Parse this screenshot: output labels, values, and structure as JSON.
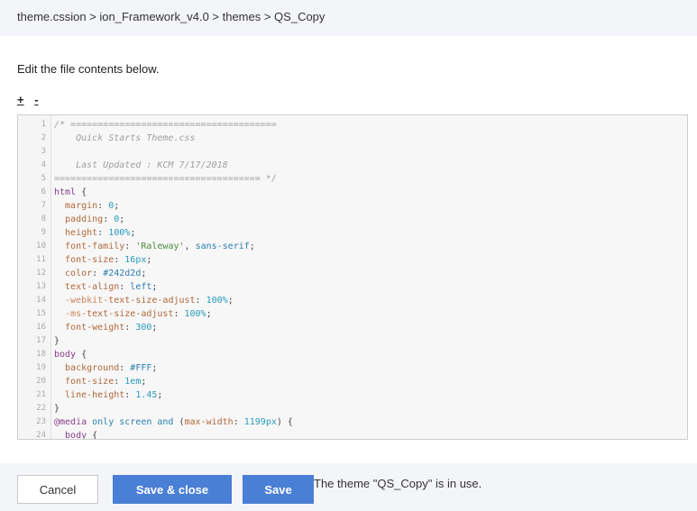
{
  "breadcrumb": {
    "text": "theme.cssion > ion_Framework_v4.0 > themes > QS_Copy"
  },
  "instructions": "Edit the file contents below.",
  "zoom": {
    "increase_label": "+",
    "decrease_label": "-"
  },
  "editor": {
    "lines": [
      {
        "num": "1",
        "tokens": [
          {
            "t": "/* ======================================",
            "c": "comment"
          }
        ]
      },
      {
        "num": "2",
        "tokens": [
          {
            "t": "    Quick Starts Theme.css",
            "c": "comment"
          }
        ]
      },
      {
        "num": "3",
        "tokens": [
          {
            "t": "",
            "c": "plain"
          }
        ]
      },
      {
        "num": "4",
        "tokens": [
          {
            "t": "    Last Updated : KCM 7/17/2018",
            "c": "comment"
          }
        ]
      },
      {
        "num": "5",
        "tokens": [
          {
            "t": "====================================== */",
            "c": "comment"
          }
        ]
      },
      {
        "num": "6",
        "tokens": [
          {
            "t": "html",
            "c": "selector"
          },
          {
            "t": " {",
            "c": "plain"
          }
        ]
      },
      {
        "num": "7",
        "tokens": [
          {
            "t": "  margin",
            "c": "prop"
          },
          {
            "t": ": ",
            "c": "plain"
          },
          {
            "t": "0",
            "c": "num"
          },
          {
            "t": ";",
            "c": "plain"
          }
        ]
      },
      {
        "num": "8",
        "tokens": [
          {
            "t": "  padding",
            "c": "prop"
          },
          {
            "t": ": ",
            "c": "plain"
          },
          {
            "t": "0",
            "c": "num"
          },
          {
            "t": ";",
            "c": "plain"
          }
        ]
      },
      {
        "num": "9",
        "tokens": [
          {
            "t": "  height",
            "c": "prop"
          },
          {
            "t": ": ",
            "c": "plain"
          },
          {
            "t": "100%",
            "c": "num"
          },
          {
            "t": ";",
            "c": "plain"
          }
        ]
      },
      {
        "num": "10",
        "tokens": [
          {
            "t": "  font-family",
            "c": "prop"
          },
          {
            "t": ": ",
            "c": "plain"
          },
          {
            "t": "'Raleway'",
            "c": "str"
          },
          {
            "t": ", ",
            "c": "plain"
          },
          {
            "t": "sans-serif",
            "c": "val"
          },
          {
            "t": ";",
            "c": "plain"
          }
        ]
      },
      {
        "num": "11",
        "tokens": [
          {
            "t": "  font-size",
            "c": "prop"
          },
          {
            "t": ": ",
            "c": "plain"
          },
          {
            "t": "16px",
            "c": "num"
          },
          {
            "t": ";",
            "c": "plain"
          }
        ]
      },
      {
        "num": "12",
        "tokens": [
          {
            "t": "  color",
            "c": "prop"
          },
          {
            "t": ": ",
            "c": "plain"
          },
          {
            "t": "#242d2d",
            "c": "val"
          },
          {
            "t": ";",
            "c": "plain"
          }
        ]
      },
      {
        "num": "13",
        "tokens": [
          {
            "t": "  text-align",
            "c": "prop"
          },
          {
            "t": ": ",
            "c": "plain"
          },
          {
            "t": "left",
            "c": "val"
          },
          {
            "t": ";",
            "c": "plain"
          }
        ]
      },
      {
        "num": "14",
        "tokens": [
          {
            "t": "  -webkit-",
            "c": "vendor"
          },
          {
            "t": "text-size-adjust",
            "c": "prop"
          },
          {
            "t": ": ",
            "c": "plain"
          },
          {
            "t": "100%",
            "c": "num"
          },
          {
            "t": ";",
            "c": "plain"
          }
        ]
      },
      {
        "num": "15",
        "tokens": [
          {
            "t": "  -ms-",
            "c": "vendor"
          },
          {
            "t": "text-size-adjust",
            "c": "prop"
          },
          {
            "t": ": ",
            "c": "plain"
          },
          {
            "t": "100%",
            "c": "num"
          },
          {
            "t": ";",
            "c": "plain"
          }
        ]
      },
      {
        "num": "16",
        "tokens": [
          {
            "t": "  font-weight",
            "c": "prop"
          },
          {
            "t": ": ",
            "c": "plain"
          },
          {
            "t": "300",
            "c": "num"
          },
          {
            "t": ";",
            "c": "plain"
          }
        ]
      },
      {
        "num": "17",
        "tokens": [
          {
            "t": "}",
            "c": "plain"
          }
        ]
      },
      {
        "num": "18",
        "tokens": [
          {
            "t": "body",
            "c": "selector"
          },
          {
            "t": " {",
            "c": "plain"
          }
        ]
      },
      {
        "num": "19",
        "tokens": [
          {
            "t": "  background",
            "c": "prop"
          },
          {
            "t": ": ",
            "c": "plain"
          },
          {
            "t": "#FFF",
            "c": "val"
          },
          {
            "t": ";",
            "c": "plain"
          }
        ]
      },
      {
        "num": "20",
        "tokens": [
          {
            "t": "  font-size",
            "c": "prop"
          },
          {
            "t": ": ",
            "c": "plain"
          },
          {
            "t": "1em",
            "c": "num"
          },
          {
            "t": ";",
            "c": "plain"
          }
        ]
      },
      {
        "num": "21",
        "tokens": [
          {
            "t": "  line-height",
            "c": "prop"
          },
          {
            "t": ": ",
            "c": "plain"
          },
          {
            "t": "1.45",
            "c": "num"
          },
          {
            "t": ";",
            "c": "plain"
          }
        ]
      },
      {
        "num": "22",
        "tokens": [
          {
            "t": "}",
            "c": "plain"
          }
        ]
      },
      {
        "num": "23",
        "tokens": [
          {
            "t": "@media",
            "c": "at"
          },
          {
            "t": " only screen and ",
            "c": "val"
          },
          {
            "t": "(",
            "c": "plain"
          },
          {
            "t": "max-width",
            "c": "prop"
          },
          {
            "t": ": ",
            "c": "plain"
          },
          {
            "t": "1199px",
            "c": "num"
          },
          {
            "t": ") {",
            "c": "plain"
          }
        ]
      },
      {
        "num": "24",
        "tokens": [
          {
            "t": "  body",
            "c": "selector"
          },
          {
            "t": " {",
            "c": "plain"
          }
        ]
      }
    ]
  },
  "footer": {
    "cancel_label": "Cancel",
    "save_close_label": "Save & close",
    "save_label": "Save",
    "status_text": "The theme \"QS_Copy\" is in use."
  },
  "colors": {
    "primary_button": "#4a7fd6",
    "header_bg": "#f4f5f9"
  }
}
